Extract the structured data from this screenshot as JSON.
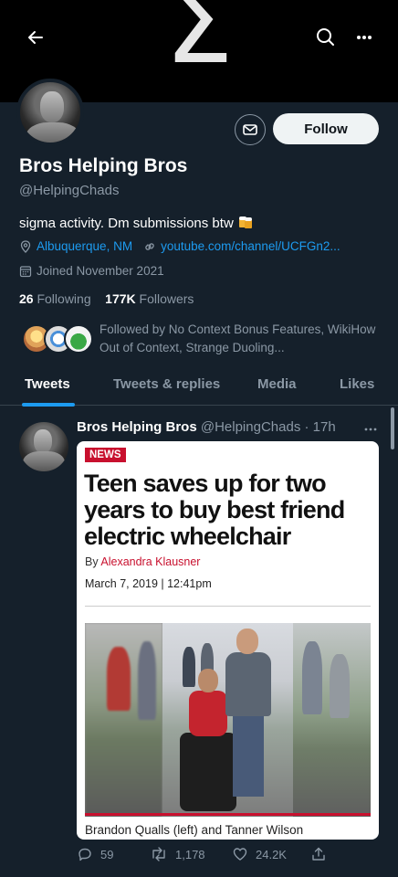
{
  "banner": {
    "symbol": "Σ"
  },
  "header": {
    "back_icon": "arrow-left-icon",
    "search_icon": "search-icon",
    "more_icon": "more-horizontal-icon"
  },
  "profile": {
    "display_name": "Bros Helping Bros",
    "handle": "@HelpingChads",
    "bio": "sigma activity. Dm submissions btw",
    "location": "Albuquerque, NM",
    "website": "youtube.com/channel/UCFGn2...",
    "joined": "Joined November 2021",
    "following_count": "26",
    "following_label": "Following",
    "followers_count": "177K",
    "followers_label": "Followers",
    "followed_by": "Followed by No Context Bonus Features, WikiHow Out of Context, Strange Duoling...",
    "follow_button": "Follow",
    "message_icon": "mail-icon"
  },
  "tabs": [
    {
      "label": "Tweets",
      "active": true
    },
    {
      "label": "Tweets & replies",
      "active": false
    },
    {
      "label": "Media",
      "active": false
    },
    {
      "label": "Likes",
      "active": false
    }
  ],
  "tweet": {
    "author_name": "Bros Helping Bros",
    "author_handle": "@HelpingChads",
    "separator": " · ",
    "time": "17h",
    "article": {
      "tag": "NEWS",
      "headline": "Teen saves up for two years to buy best friend electric wheelchair",
      "by_prefix": "By ",
      "author": "Alexandra Klausner",
      "date": "March 7, 2019 | 12:41pm",
      "caption": "Brandon Qualls (left) and Tanner Wilson"
    },
    "replies": "59",
    "retweets": "1,178",
    "likes": "24.2K"
  },
  "colors": {
    "background": "#15202b",
    "accent": "#1d9bf0",
    "secondary_text": "#8b98a5",
    "news_red": "#c8102e"
  }
}
